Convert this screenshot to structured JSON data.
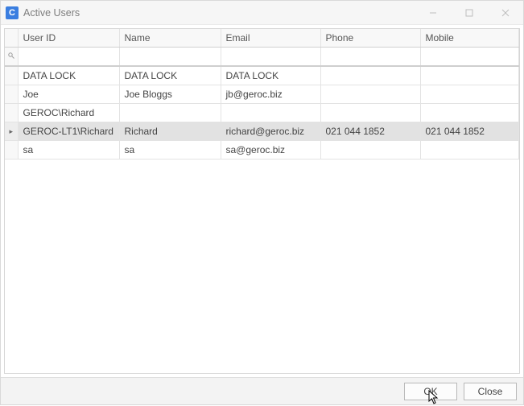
{
  "window": {
    "title": "Active Users",
    "app_icon_letter": "C"
  },
  "columns": {
    "user_id": "User ID",
    "name": "Name",
    "email": "Email",
    "phone": "Phone",
    "mobile": "Mobile"
  },
  "filter": {
    "user_id": "",
    "name": "",
    "email": "",
    "phone": "",
    "mobile": ""
  },
  "rows": [
    {
      "selected": false,
      "user_id": "DATA LOCK",
      "name": "DATA LOCK",
      "email": "DATA LOCK",
      "phone": "",
      "mobile": ""
    },
    {
      "selected": false,
      "user_id": "Joe",
      "name": "Joe Bloggs",
      "email": "jb@geroc.biz",
      "phone": "",
      "mobile": ""
    },
    {
      "selected": false,
      "user_id": "GEROC\\Richard",
      "name": "",
      "email": "",
      "phone": "",
      "mobile": ""
    },
    {
      "selected": true,
      "user_id": "GEROC-LT1\\Richard",
      "name": "Richard",
      "email": "richard@geroc.biz",
      "phone": "021 044 1852",
      "mobile": "021 044 1852"
    },
    {
      "selected": false,
      "user_id": "sa",
      "name": "sa",
      "email": "sa@geroc.biz",
      "phone": "",
      "mobile": ""
    }
  ],
  "buttons": {
    "ok": "OK",
    "close": "Close"
  }
}
